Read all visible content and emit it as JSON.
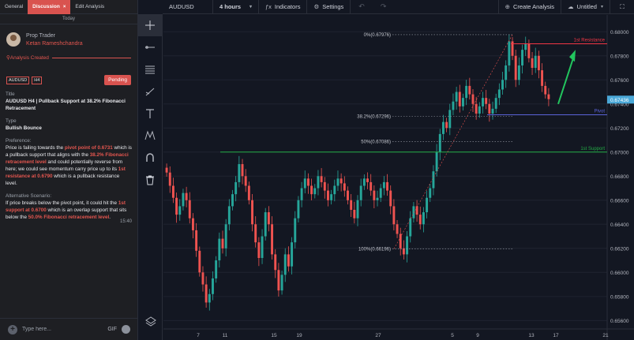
{
  "tabs": [
    {
      "label": "General"
    },
    {
      "label": "Discussion",
      "close": "×"
    },
    {
      "label": "Edit Analysis"
    }
  ],
  "today_label": "Today",
  "author": {
    "role": "Prop Trader",
    "name": "Ketan Rameshchandra"
  },
  "status_line": "Analysis Created",
  "tags": [
    "AUDUSD",
    "H4"
  ],
  "status_badge": "Pending",
  "title_label": "Title",
  "title_value": "AUDUSD H4 | Pullback Support at 38.2% Fibonacci Retracement",
  "type_label": "Type",
  "type_value": "Bullish Bounce",
  "preference_label": "Preference:",
  "preference": {
    "p1": "Price is failing towards the ",
    "h1": "pivot point of 0.6731",
    "p2": " which is a pullback support that aligns with the ",
    "h2": "38.2% Fibonacci retracement level",
    "p3": " and could potentially reverse from here; we could see momentum carry price up to its ",
    "h3": "1st resistance at 0.6790",
    "p4": " which is a pullback resistance level."
  },
  "alt_label": "Alternative Scenario:",
  "alternative": {
    "p1": "If price breaks below the pivot point, it could hit the ",
    "h1": "1st support at 0.6700",
    "p2": " which is an overlap support that sits below the ",
    "h2": "50.0% Fibonacci retracement level",
    "p3": "."
  },
  "message_time": "15:40",
  "chat": {
    "placeholder": "Type here...",
    "gif": "GIF"
  },
  "topbar": {
    "symbol": "AUDUSD",
    "interval": "4 hours",
    "indicators": "Indicators",
    "settings": "Settings",
    "create_analysis": "Create Analysis",
    "untitled": "Untitled"
  },
  "tools": [
    "crosshair-icon",
    "horizontal-line-icon",
    "fib-levels-icon",
    "trend-line-icon",
    "text-icon",
    "pattern-icon",
    "magnet-icon",
    "trash-icon"
  ],
  "chart_data": {
    "type": "candlestick",
    "symbol": "AUDUSD",
    "interval": "4 hours",
    "price_ticks": [
      "0.68000",
      "0.67800",
      "0.67600",
      "0.67400",
      "0.67200",
      "0.67000",
      "0.66800",
      "0.66600",
      "0.66400",
      "0.66200",
      "0.66000",
      "0.65800",
      "0.65600"
    ],
    "date_ticks": [
      "7",
      "11",
      "15",
      "19",
      "27",
      "5",
      "9",
      "13",
      "17",
      "21"
    ],
    "current_price": "0.67436",
    "levels": [
      {
        "label": "1st Resistance",
        "price": 0.679,
        "color": "#f23645"
      },
      {
        "label": "Pivot",
        "price": 0.6731,
        "color": "#5b63d9"
      },
      {
        "label": "1st Support",
        "price": 0.67,
        "color": "#22ab45"
      }
    ],
    "fibonacci": [
      {
        "label": "0%(0.67976)",
        "price": 0.67976
      },
      {
        "label": "38.2%(0.67296)",
        "price": 0.67296
      },
      {
        "label": "50%(0.67086)",
        "price": 0.67086
      },
      {
        "label": "100%(0.66196)",
        "price": 0.66196
      }
    ],
    "closes": [
      0.6683,
      0.6672,
      0.6662,
      0.6648,
      0.6655,
      0.6666,
      0.666,
      0.6645,
      0.6635,
      0.6618,
      0.66,
      0.659,
      0.6575,
      0.6582,
      0.6595,
      0.661,
      0.6628,
      0.662,
      0.664,
      0.6655,
      0.6665,
      0.6675,
      0.669,
      0.668,
      0.6672,
      0.666,
      0.664,
      0.6625,
      0.6612,
      0.663,
      0.665,
      0.664,
      0.6615,
      0.6602,
      0.6585,
      0.6598,
      0.6615,
      0.6605,
      0.6625,
      0.6645,
      0.666,
      0.667,
      0.6678,
      0.6672,
      0.6665,
      0.667,
      0.668,
      0.6675,
      0.6668,
      0.666,
      0.6665,
      0.6672,
      0.6678,
      0.6674,
      0.6668,
      0.666,
      0.6652,
      0.6645,
      0.666,
      0.6672,
      0.6678,
      0.6675,
      0.6668,
      0.666,
      0.6662,
      0.667,
      0.6675,
      0.6668,
      0.6655,
      0.664,
      0.6632,
      0.662,
      0.6615,
      0.663,
      0.6645,
      0.6655,
      0.6648,
      0.664,
      0.665,
      0.6662,
      0.667,
      0.6684,
      0.67,
      0.6715,
      0.6725,
      0.672,
      0.6735,
      0.6742,
      0.675,
      0.6738,
      0.6745,
      0.6755,
      0.6748,
      0.674,
      0.6732,
      0.6738,
      0.6745,
      0.674,
      0.6732,
      0.6736,
      0.6745,
      0.6752,
      0.676,
      0.6772,
      0.6792,
      0.678,
      0.676,
      0.6772,
      0.6785,
      0.679,
      0.6778,
      0.677,
      0.678,
      0.6768,
      0.6755,
      0.6748,
      0.6744
    ]
  }
}
